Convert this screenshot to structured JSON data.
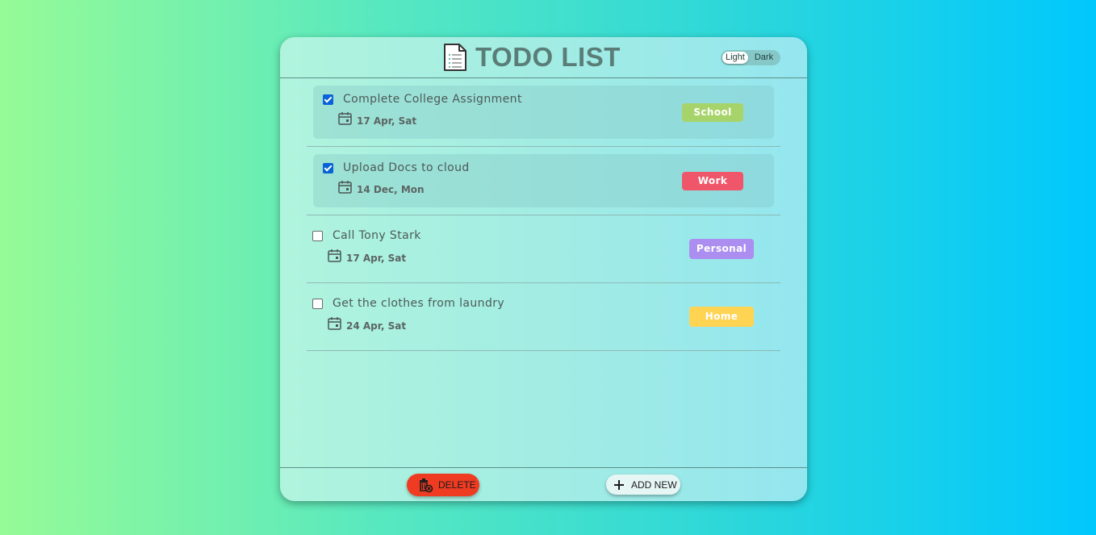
{
  "app": {
    "title": "TODO LIST"
  },
  "theme": {
    "options": [
      "Light",
      "Dark"
    ],
    "selected": "Light"
  },
  "tasks": [
    {
      "name": "Complete College Assignment",
      "date": "17 Apr, Sat",
      "category": "School",
      "category_color": "#a7d46a",
      "completed": true
    },
    {
      "name": "Upload Docs to cloud",
      "date": "14 Dec, Mon",
      "category": "Work",
      "category_color": "#f0566a",
      "completed": true
    },
    {
      "name": "Call Tony Stark",
      "date": "17 Apr, Sat",
      "category": "Personal",
      "category_color": "#ab8ef0",
      "completed": false
    },
    {
      "name": "Get the clothes from laundry",
      "date": "24 Apr, Sat",
      "category": "Home",
      "category_color": "#ffd453",
      "completed": false
    }
  ],
  "footer": {
    "delete_label": "DELETE",
    "add_label": "ADD NEW"
  },
  "colors": {
    "accent_delete": "#ef3b22",
    "checkbox_checked": "#0a63d6"
  },
  "icons": {
    "header": "document-list-icon",
    "date": "calendar-icon",
    "delete": "trash-icon",
    "add": "plus-icon"
  }
}
